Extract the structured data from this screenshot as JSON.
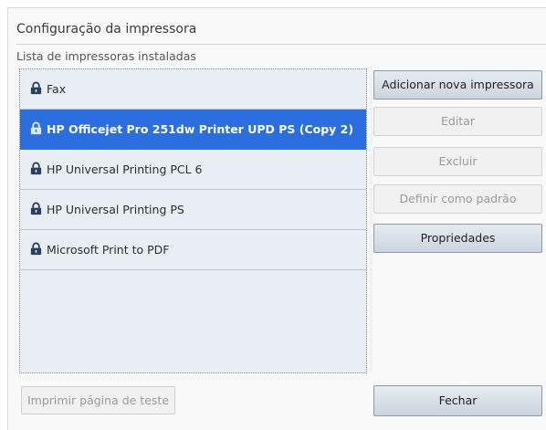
{
  "dialog": {
    "title": "Configuração da impressora",
    "list_label": "Lista de impressoras instaladas"
  },
  "printers": [
    {
      "name": "Fax",
      "selected": false,
      "icon": "lock-icon"
    },
    {
      "name": "HP Officejet Pro 251dw Printer UPD PS (Copy 2)",
      "selected": true,
      "icon": "lock-icon"
    },
    {
      "name": "HP Universal Printing PCL 6",
      "selected": false,
      "icon": "lock-icon"
    },
    {
      "name": "HP Universal Printing PS",
      "selected": false,
      "icon": "lock-icon"
    },
    {
      "name": "Microsoft Print to PDF",
      "selected": false,
      "icon": "lock-icon"
    }
  ],
  "buttons": {
    "add_printer": "Adicionar nova impressora",
    "edit": "Editar",
    "delete": "Excluir",
    "set_default": "Definir como padrão",
    "properties": "Propriedades",
    "print_test_page": "Imprimir página de teste",
    "close": "Fechar"
  },
  "colors": {
    "selection": "#2b6ee0",
    "list_background": "#e9eef5",
    "lock_icon": "#2a3f66"
  }
}
